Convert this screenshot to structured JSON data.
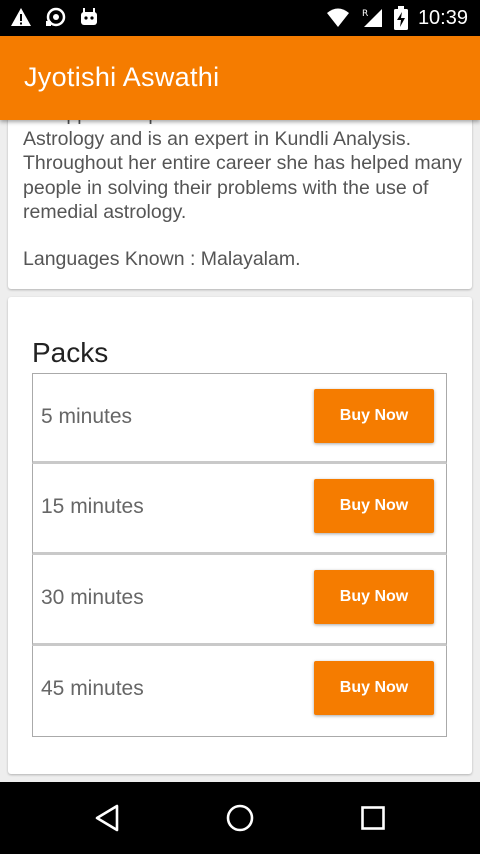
{
  "status_bar": {
    "time": "10:39",
    "left_icons": [
      "warning-icon",
      "cast-icon",
      "android-icon"
    ],
    "right_icons": [
      "wifi-icon",
      "signal-roaming-icon",
      "battery-charging-icon"
    ]
  },
  "app_bar": {
    "title": "Jyotishi Aswathi",
    "background": "#f57c00"
  },
  "about": {
    "partial_line": "Ballappan Thripunithura. She is well versed in",
    "text": "Astrology and is an expert in Kundli Analysis. Throughout her entire career she has helped many people in solving their problems with the use of remedial astrology.",
    "languages": "Languages Known : Malayalam."
  },
  "packs": {
    "title": "Packs",
    "items": [
      {
        "label": "5 minutes",
        "button": "Buy Now"
      },
      {
        "label": "15 minutes",
        "button": "Buy Now"
      },
      {
        "label": "30 minutes",
        "button": "Buy Now"
      },
      {
        "label": "45 minutes",
        "button": "Buy Now"
      }
    ]
  },
  "nav_bar": {
    "buttons": [
      "back-icon",
      "home-icon",
      "recents-icon"
    ]
  }
}
